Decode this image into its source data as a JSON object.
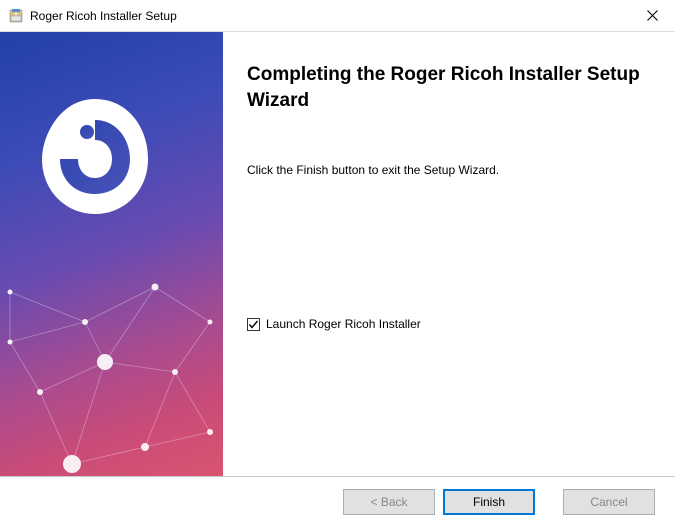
{
  "window": {
    "title": "Roger Ricoh Installer Setup"
  },
  "main": {
    "heading": "Completing the Roger Ricoh Installer Setup Wizard",
    "body": "Click the Finish button to exit the Setup Wizard.",
    "checkbox_label": "Launch Roger Ricoh Installer",
    "checkbox_checked": true
  },
  "buttons": {
    "back": "< Back",
    "finish": "Finish",
    "cancel": "Cancel"
  }
}
